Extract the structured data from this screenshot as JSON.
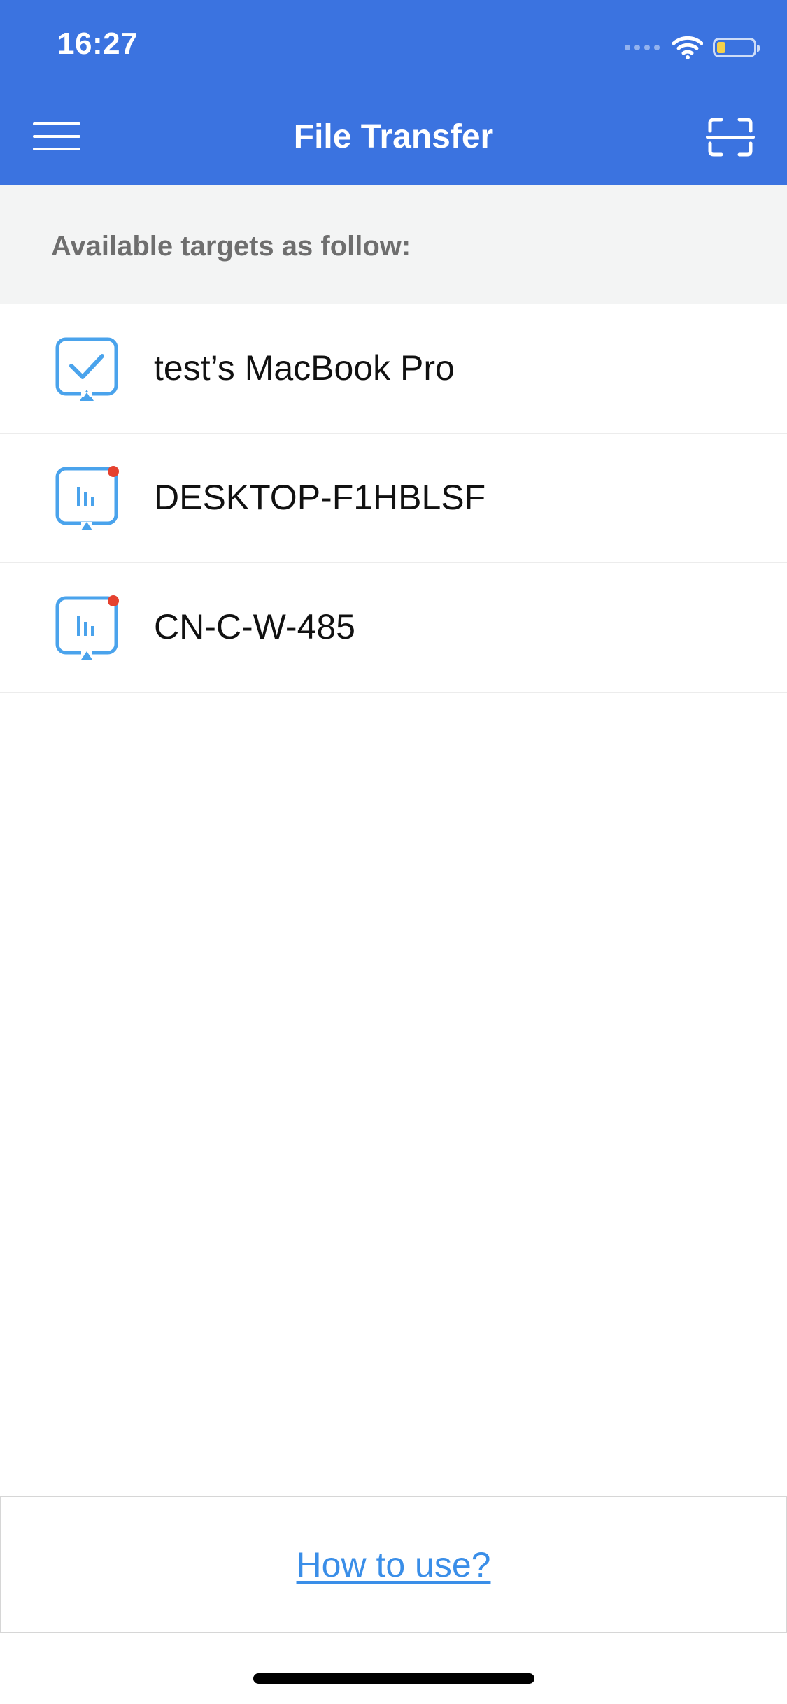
{
  "status_bar": {
    "time": "16:27",
    "battery_color": "#f5d14a"
  },
  "nav_bar": {
    "title": "File Transfer",
    "left_icon": "hamburger-menu-icon",
    "right_icon": "scan-icon",
    "background_color": "#3b73e0"
  },
  "section": {
    "label": "Available targets as follow:"
  },
  "devices": [
    {
      "name": "test’s MacBook Pro",
      "icon": "mac-connected-icon",
      "badge": false
    },
    {
      "name": "DESKTOP-F1HBLSF",
      "icon": "pc-device-icon",
      "badge": true
    },
    {
      "name": "CN-C-W-485",
      "icon": "pc-device-icon",
      "badge": true
    }
  ],
  "footer": {
    "link_label": "How to use?"
  },
  "colors": {
    "accent": "#3b73e0",
    "icon_blue": "#4aa3ec",
    "badge_red": "#e5412f",
    "link_blue": "#3a8ee8"
  }
}
